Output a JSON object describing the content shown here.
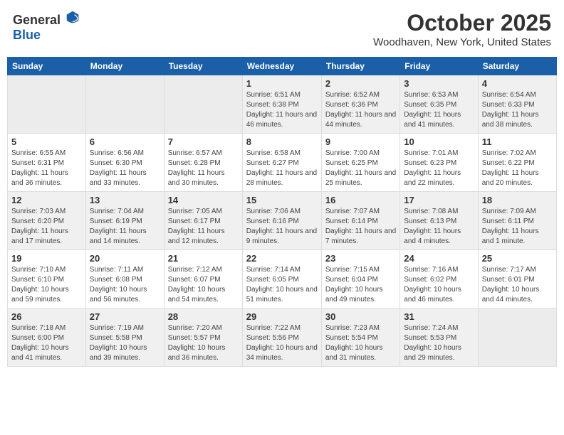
{
  "header": {
    "logo_general": "General",
    "logo_blue": "Blue",
    "month": "October 2025",
    "location": "Woodhaven, New York, United States"
  },
  "days_of_week": [
    "Sunday",
    "Monday",
    "Tuesday",
    "Wednesday",
    "Thursday",
    "Friday",
    "Saturday"
  ],
  "weeks": [
    [
      {
        "day": "",
        "info": ""
      },
      {
        "day": "",
        "info": ""
      },
      {
        "day": "",
        "info": ""
      },
      {
        "day": "1",
        "info": "Sunrise: 6:51 AM\nSunset: 6:38 PM\nDaylight: 11 hours and 46 minutes."
      },
      {
        "day": "2",
        "info": "Sunrise: 6:52 AM\nSunset: 6:36 PM\nDaylight: 11 hours and 44 minutes."
      },
      {
        "day": "3",
        "info": "Sunrise: 6:53 AM\nSunset: 6:35 PM\nDaylight: 11 hours and 41 minutes."
      },
      {
        "day": "4",
        "info": "Sunrise: 6:54 AM\nSunset: 6:33 PM\nDaylight: 11 hours and 38 minutes."
      }
    ],
    [
      {
        "day": "5",
        "info": "Sunrise: 6:55 AM\nSunset: 6:31 PM\nDaylight: 11 hours and 36 minutes."
      },
      {
        "day": "6",
        "info": "Sunrise: 6:56 AM\nSunset: 6:30 PM\nDaylight: 11 hours and 33 minutes."
      },
      {
        "day": "7",
        "info": "Sunrise: 6:57 AM\nSunset: 6:28 PM\nDaylight: 11 hours and 30 minutes."
      },
      {
        "day": "8",
        "info": "Sunrise: 6:58 AM\nSunset: 6:27 PM\nDaylight: 11 hours and 28 minutes."
      },
      {
        "day": "9",
        "info": "Sunrise: 7:00 AM\nSunset: 6:25 PM\nDaylight: 11 hours and 25 minutes."
      },
      {
        "day": "10",
        "info": "Sunrise: 7:01 AM\nSunset: 6:23 PM\nDaylight: 11 hours and 22 minutes."
      },
      {
        "day": "11",
        "info": "Sunrise: 7:02 AM\nSunset: 6:22 PM\nDaylight: 11 hours and 20 minutes."
      }
    ],
    [
      {
        "day": "12",
        "info": "Sunrise: 7:03 AM\nSunset: 6:20 PM\nDaylight: 11 hours and 17 minutes."
      },
      {
        "day": "13",
        "info": "Sunrise: 7:04 AM\nSunset: 6:19 PM\nDaylight: 11 hours and 14 minutes."
      },
      {
        "day": "14",
        "info": "Sunrise: 7:05 AM\nSunset: 6:17 PM\nDaylight: 11 hours and 12 minutes."
      },
      {
        "day": "15",
        "info": "Sunrise: 7:06 AM\nSunset: 6:16 PM\nDaylight: 11 hours and 9 minutes."
      },
      {
        "day": "16",
        "info": "Sunrise: 7:07 AM\nSunset: 6:14 PM\nDaylight: 11 hours and 7 minutes."
      },
      {
        "day": "17",
        "info": "Sunrise: 7:08 AM\nSunset: 6:13 PM\nDaylight: 11 hours and 4 minutes."
      },
      {
        "day": "18",
        "info": "Sunrise: 7:09 AM\nSunset: 6:11 PM\nDaylight: 11 hours and 1 minute."
      }
    ],
    [
      {
        "day": "19",
        "info": "Sunrise: 7:10 AM\nSunset: 6:10 PM\nDaylight: 10 hours and 59 minutes."
      },
      {
        "day": "20",
        "info": "Sunrise: 7:11 AM\nSunset: 6:08 PM\nDaylight: 10 hours and 56 minutes."
      },
      {
        "day": "21",
        "info": "Sunrise: 7:12 AM\nSunset: 6:07 PM\nDaylight: 10 hours and 54 minutes."
      },
      {
        "day": "22",
        "info": "Sunrise: 7:14 AM\nSunset: 6:05 PM\nDaylight: 10 hours and 51 minutes."
      },
      {
        "day": "23",
        "info": "Sunrise: 7:15 AM\nSunset: 6:04 PM\nDaylight: 10 hours and 49 minutes."
      },
      {
        "day": "24",
        "info": "Sunrise: 7:16 AM\nSunset: 6:02 PM\nDaylight: 10 hours and 46 minutes."
      },
      {
        "day": "25",
        "info": "Sunrise: 7:17 AM\nSunset: 6:01 PM\nDaylight: 10 hours and 44 minutes."
      }
    ],
    [
      {
        "day": "26",
        "info": "Sunrise: 7:18 AM\nSunset: 6:00 PM\nDaylight: 10 hours and 41 minutes."
      },
      {
        "day": "27",
        "info": "Sunrise: 7:19 AM\nSunset: 5:58 PM\nDaylight: 10 hours and 39 minutes."
      },
      {
        "day": "28",
        "info": "Sunrise: 7:20 AM\nSunset: 5:57 PM\nDaylight: 10 hours and 36 minutes."
      },
      {
        "day": "29",
        "info": "Sunrise: 7:22 AM\nSunset: 5:56 PM\nDaylight: 10 hours and 34 minutes."
      },
      {
        "day": "30",
        "info": "Sunrise: 7:23 AM\nSunset: 5:54 PM\nDaylight: 10 hours and 31 minutes."
      },
      {
        "day": "31",
        "info": "Sunrise: 7:24 AM\nSunset: 5:53 PM\nDaylight: 10 hours and 29 minutes."
      },
      {
        "day": "",
        "info": ""
      }
    ]
  ]
}
